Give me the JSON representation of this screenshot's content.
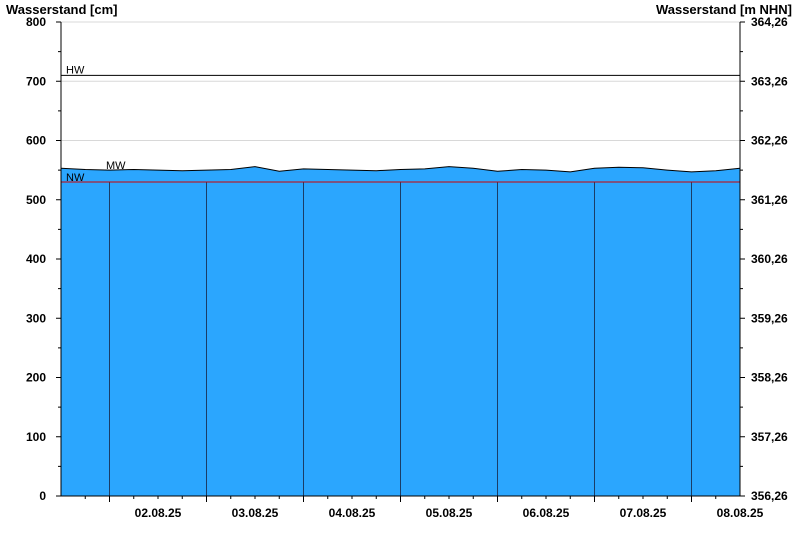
{
  "chart_data": {
    "type": "area",
    "ylabel_left": "Wasserstand [cm]",
    "ylabel_right": "Wasserstand [m NHN]",
    "ylim": [
      0,
      800
    ],
    "yticks_left": [
      "0",
      "100",
      "200",
      "300",
      "400",
      "500",
      "600",
      "700",
      "800"
    ],
    "yticks_right": [
      "356,26",
      "357,26",
      "358,26",
      "359,26",
      "360,26",
      "361,26",
      "362,26",
      "363,26",
      "364,26"
    ],
    "xlim": [
      "2025-08-01 12:00",
      "2025-08-08 12:00"
    ],
    "x_day_labels": [
      "02.08.25",
      "03.08.25",
      "04.08.25",
      "05.08.25",
      "06.08.25",
      "07.08.25",
      "08.08.25"
    ],
    "reference_lines": [
      {
        "label": "HW",
        "value": 710,
        "color": "#000000"
      },
      {
        "label": "MW",
        "value": 550,
        "color": "#000000"
      },
      {
        "label": "NW",
        "value": 530,
        "color": "#cc0000"
      }
    ],
    "series": [
      {
        "x": [
          "2025-08-01 12:00",
          "2025-08-01 18:00",
          "2025-08-02 00:00",
          "2025-08-02 06:00",
          "2025-08-02 12:00",
          "2025-08-02 18:00",
          "2025-08-03 00:00",
          "2025-08-03 06:00",
          "2025-08-03 12:00",
          "2025-08-03 18:00",
          "2025-08-04 00:00",
          "2025-08-04 06:00",
          "2025-08-04 12:00",
          "2025-08-04 18:00",
          "2025-08-05 00:00",
          "2025-08-05 06:00",
          "2025-08-05 12:00",
          "2025-08-05 18:00",
          "2025-08-06 00:00",
          "2025-08-06 06:00",
          "2025-08-06 12:00",
          "2025-08-06 18:00",
          "2025-08-07 00:00",
          "2025-08-07 06:00",
          "2025-08-07 12:00",
          "2025-08-07 18:00",
          "2025-08-08 00:00",
          "2025-08-08 06:00",
          "2025-08-08 12:00"
        ],
        "values": [
          553,
          551,
          550,
          551,
          550,
          549,
          550,
          551,
          556,
          548,
          552,
          551,
          550,
          549,
          551,
          552,
          556,
          553,
          548,
          551,
          550,
          547,
          553,
          555,
          554,
          550,
          547,
          549,
          553
        ],
        "color": "#2ba6fe"
      }
    ],
    "colors": {
      "area": "#2ba6fe",
      "area_line": "#000000",
      "grid": "#d8d8d8",
      "day_line": "#1a3d66",
      "nw_line": "#cc0000"
    }
  }
}
